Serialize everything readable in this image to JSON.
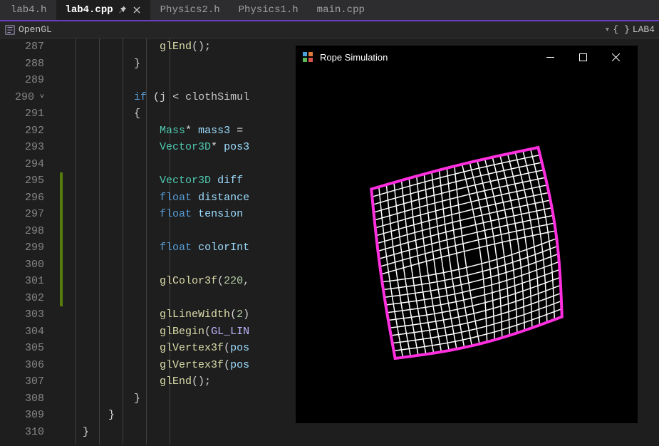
{
  "tabs": [
    {
      "label": "lab4.h",
      "active": false,
      "pinned": false,
      "closable": false
    },
    {
      "label": "lab4.cpp",
      "active": true,
      "pinned": true,
      "closable": true
    },
    {
      "label": "Physics2.h",
      "active": false,
      "pinned": false,
      "closable": false
    },
    {
      "label": "Physics1.h",
      "active": false,
      "pinned": false,
      "closable": false
    },
    {
      "label": "main.cpp",
      "active": false,
      "pinned": false,
      "closable": false
    }
  ],
  "breadcrumb": {
    "left_scope": "OpenGL",
    "right_scope": "LAB4",
    "brace_glyph": "{ }"
  },
  "editor": {
    "first_line": 287,
    "last_line": 310,
    "fold_at_line": 290,
    "change_marker_start_line": 295,
    "change_marker_end_line": 302,
    "indent_guides_cols": [
      1,
      2,
      3,
      4,
      5
    ],
    "lines": [
      {
        "n": 287,
        "tokens": [
          [
            "              ",
            ""
          ],
          [
            "glEnd",
            "fn"
          ],
          [
            "();",
            "pun"
          ]
        ]
      },
      {
        "n": 288,
        "tokens": [
          [
            "          ",
            ""
          ],
          [
            "}",
            "brc"
          ]
        ]
      },
      {
        "n": 289,
        "tokens": [
          [
            "",
            ""
          ]
        ]
      },
      {
        "n": 290,
        "tokens": [
          [
            "          ",
            ""
          ],
          [
            "if",
            "kw"
          ],
          [
            " (",
            ""
          ],
          [
            "j",
            "id"
          ],
          [
            " < ",
            ""
          ],
          [
            "clothSimul",
            "id"
          ]
        ]
      },
      {
        "n": 291,
        "tokens": [
          [
            "          ",
            ""
          ],
          [
            "{",
            "brc"
          ]
        ]
      },
      {
        "n": 292,
        "tokens": [
          [
            "              ",
            ""
          ],
          [
            "Mass",
            "type"
          ],
          [
            "* ",
            ""
          ],
          [
            "mass3",
            "var"
          ],
          [
            " = ",
            ""
          ]
        ]
      },
      {
        "n": 293,
        "tokens": [
          [
            "              ",
            ""
          ],
          [
            "Vector3D",
            "type"
          ],
          [
            "* ",
            ""
          ],
          [
            "pos3",
            "var"
          ]
        ]
      },
      {
        "n": 294,
        "tokens": [
          [
            "",
            ""
          ]
        ]
      },
      {
        "n": 295,
        "tokens": [
          [
            "              ",
            ""
          ],
          [
            "Vector3D",
            "type"
          ],
          [
            " ",
            ""
          ],
          [
            "diff",
            "var"
          ]
        ]
      },
      {
        "n": 296,
        "tokens": [
          [
            "              ",
            ""
          ],
          [
            "float",
            "kw"
          ],
          [
            " ",
            ""
          ],
          [
            "distance",
            "var"
          ]
        ]
      },
      {
        "n": 297,
        "tokens": [
          [
            "              ",
            ""
          ],
          [
            "float",
            "kw"
          ],
          [
            " ",
            ""
          ],
          [
            "tension",
            "var"
          ]
        ]
      },
      {
        "n": 298,
        "tokens": [
          [
            "",
            ""
          ]
        ]
      },
      {
        "n": 299,
        "tokens": [
          [
            "              ",
            ""
          ],
          [
            "float",
            "kw"
          ],
          [
            " ",
            ""
          ],
          [
            "colorInt",
            "var"
          ]
        ]
      },
      {
        "n": 300,
        "tokens": [
          [
            "",
            ""
          ]
        ]
      },
      {
        "n": 301,
        "tokens": [
          [
            "              ",
            ""
          ],
          [
            "glColor3f",
            "fn"
          ],
          [
            "(",
            ""
          ],
          [
            "220",
            "num"
          ],
          [
            ",",
            ""
          ]
        ]
      },
      {
        "n": 302,
        "tokens": [
          [
            "",
            ""
          ]
        ]
      },
      {
        "n": 303,
        "tokens": [
          [
            "              ",
            ""
          ],
          [
            "glLineWidth",
            "fn"
          ],
          [
            "(",
            ""
          ],
          [
            "2",
            "num"
          ],
          [
            ")",
            ""
          ]
        ]
      },
      {
        "n": 304,
        "tokens": [
          [
            "              ",
            ""
          ],
          [
            "glBegin",
            "fn"
          ],
          [
            "(",
            ""
          ],
          [
            "GL_LIN",
            "mac"
          ]
        ]
      },
      {
        "n": 305,
        "tokens": [
          [
            "              ",
            ""
          ],
          [
            "glVertex3f",
            "fn"
          ],
          [
            "(",
            ""
          ],
          [
            "pos",
            "var"
          ]
        ]
      },
      {
        "n": 306,
        "tokens": [
          [
            "              ",
            ""
          ],
          [
            "glVertex3f",
            "fn"
          ],
          [
            "(",
            ""
          ],
          [
            "pos",
            "var"
          ]
        ]
      },
      {
        "n": 307,
        "tokens": [
          [
            "              ",
            ""
          ],
          [
            "glEnd",
            "fn"
          ],
          [
            "();",
            "pun"
          ]
        ]
      },
      {
        "n": 308,
        "tokens": [
          [
            "          ",
            ""
          ],
          [
            "}",
            "brc"
          ]
        ]
      },
      {
        "n": 309,
        "tokens": [
          [
            "      ",
            ""
          ],
          [
            "}",
            "brc"
          ]
        ]
      },
      {
        "n": 310,
        "tokens": [
          [
            "  ",
            ""
          ],
          [
            "}",
            "brc"
          ]
        ]
      }
    ]
  },
  "sim_window": {
    "title": "Rope Simulation",
    "content": {
      "description": "cloth-mesh",
      "grid_cells": 22,
      "fill_color": "#ffffff",
      "border_color": "#ff2fe0"
    }
  },
  "colors": {
    "editor_bg": "#1e1e1e",
    "tab_bg": "#2d2d30",
    "accent": "#6a3fc4",
    "change_marker": "#587c0c",
    "cloth_edge": "#ff2fe0"
  },
  "glyphs": {
    "pin": "⯑",
    "close": "✕",
    "chev_down_small": "˅",
    "chev_down_big": "▾",
    "minimize": "—",
    "maximize": "□"
  }
}
